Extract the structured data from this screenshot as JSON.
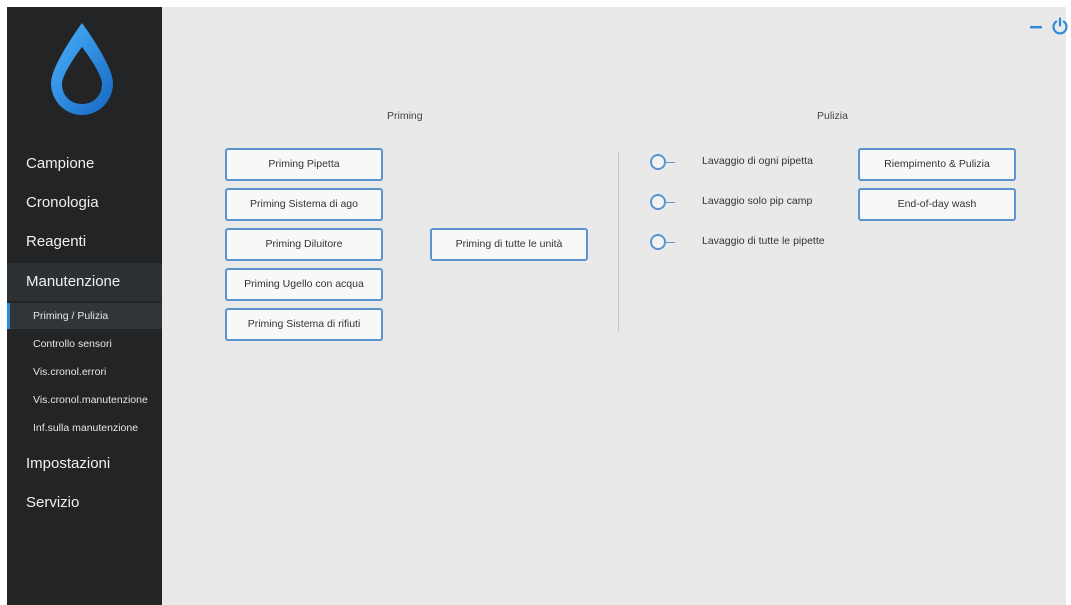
{
  "sidebar": {
    "logo": "water-drop-logo",
    "items": [
      {
        "label": "Campione"
      },
      {
        "label": "Cronologia"
      },
      {
        "label": "Reagenti"
      },
      {
        "label": "Manutenzione"
      },
      {
        "label": "Impostazioni"
      },
      {
        "label": "Servizio"
      }
    ],
    "subitems": [
      {
        "label": "Priming / Pulizia"
      },
      {
        "label": "Controllo sensori"
      },
      {
        "label": "Vis.cronol.errori"
      },
      {
        "label": "Vis.cronol.manutenzione"
      },
      {
        "label": "Inf.sulla manutenzione"
      }
    ]
  },
  "window": {
    "minimize_icon": "minimize-icon",
    "power_icon": "power-icon"
  },
  "priming": {
    "title": "Priming",
    "buttons": [
      {
        "label": "Priming Pipetta"
      },
      {
        "label": "Priming Sistema di ago"
      },
      {
        "label": "Priming Diluitore"
      },
      {
        "label": "Priming Ugello con acqua"
      },
      {
        "label": "Priming Sistema di rifiuti"
      }
    ],
    "all_button": "Priming di tutte le unità"
  },
  "pulizia": {
    "title": "Pulizia",
    "options": [
      {
        "label": "Lavaggio di ogni pipetta"
      },
      {
        "label": "Lavaggio solo pip camp"
      },
      {
        "label": "Lavaggio di tutte le pipette"
      }
    ],
    "buttons": [
      {
        "label": "Riempimento & Pulizia"
      },
      {
        "label": "End-of-day wash"
      }
    ]
  },
  "colors": {
    "sidebar_bg": "#222426",
    "accent": "#2f8ad8",
    "button_border": "#5b94cf",
    "content_bg": "#e9e9e9"
  }
}
